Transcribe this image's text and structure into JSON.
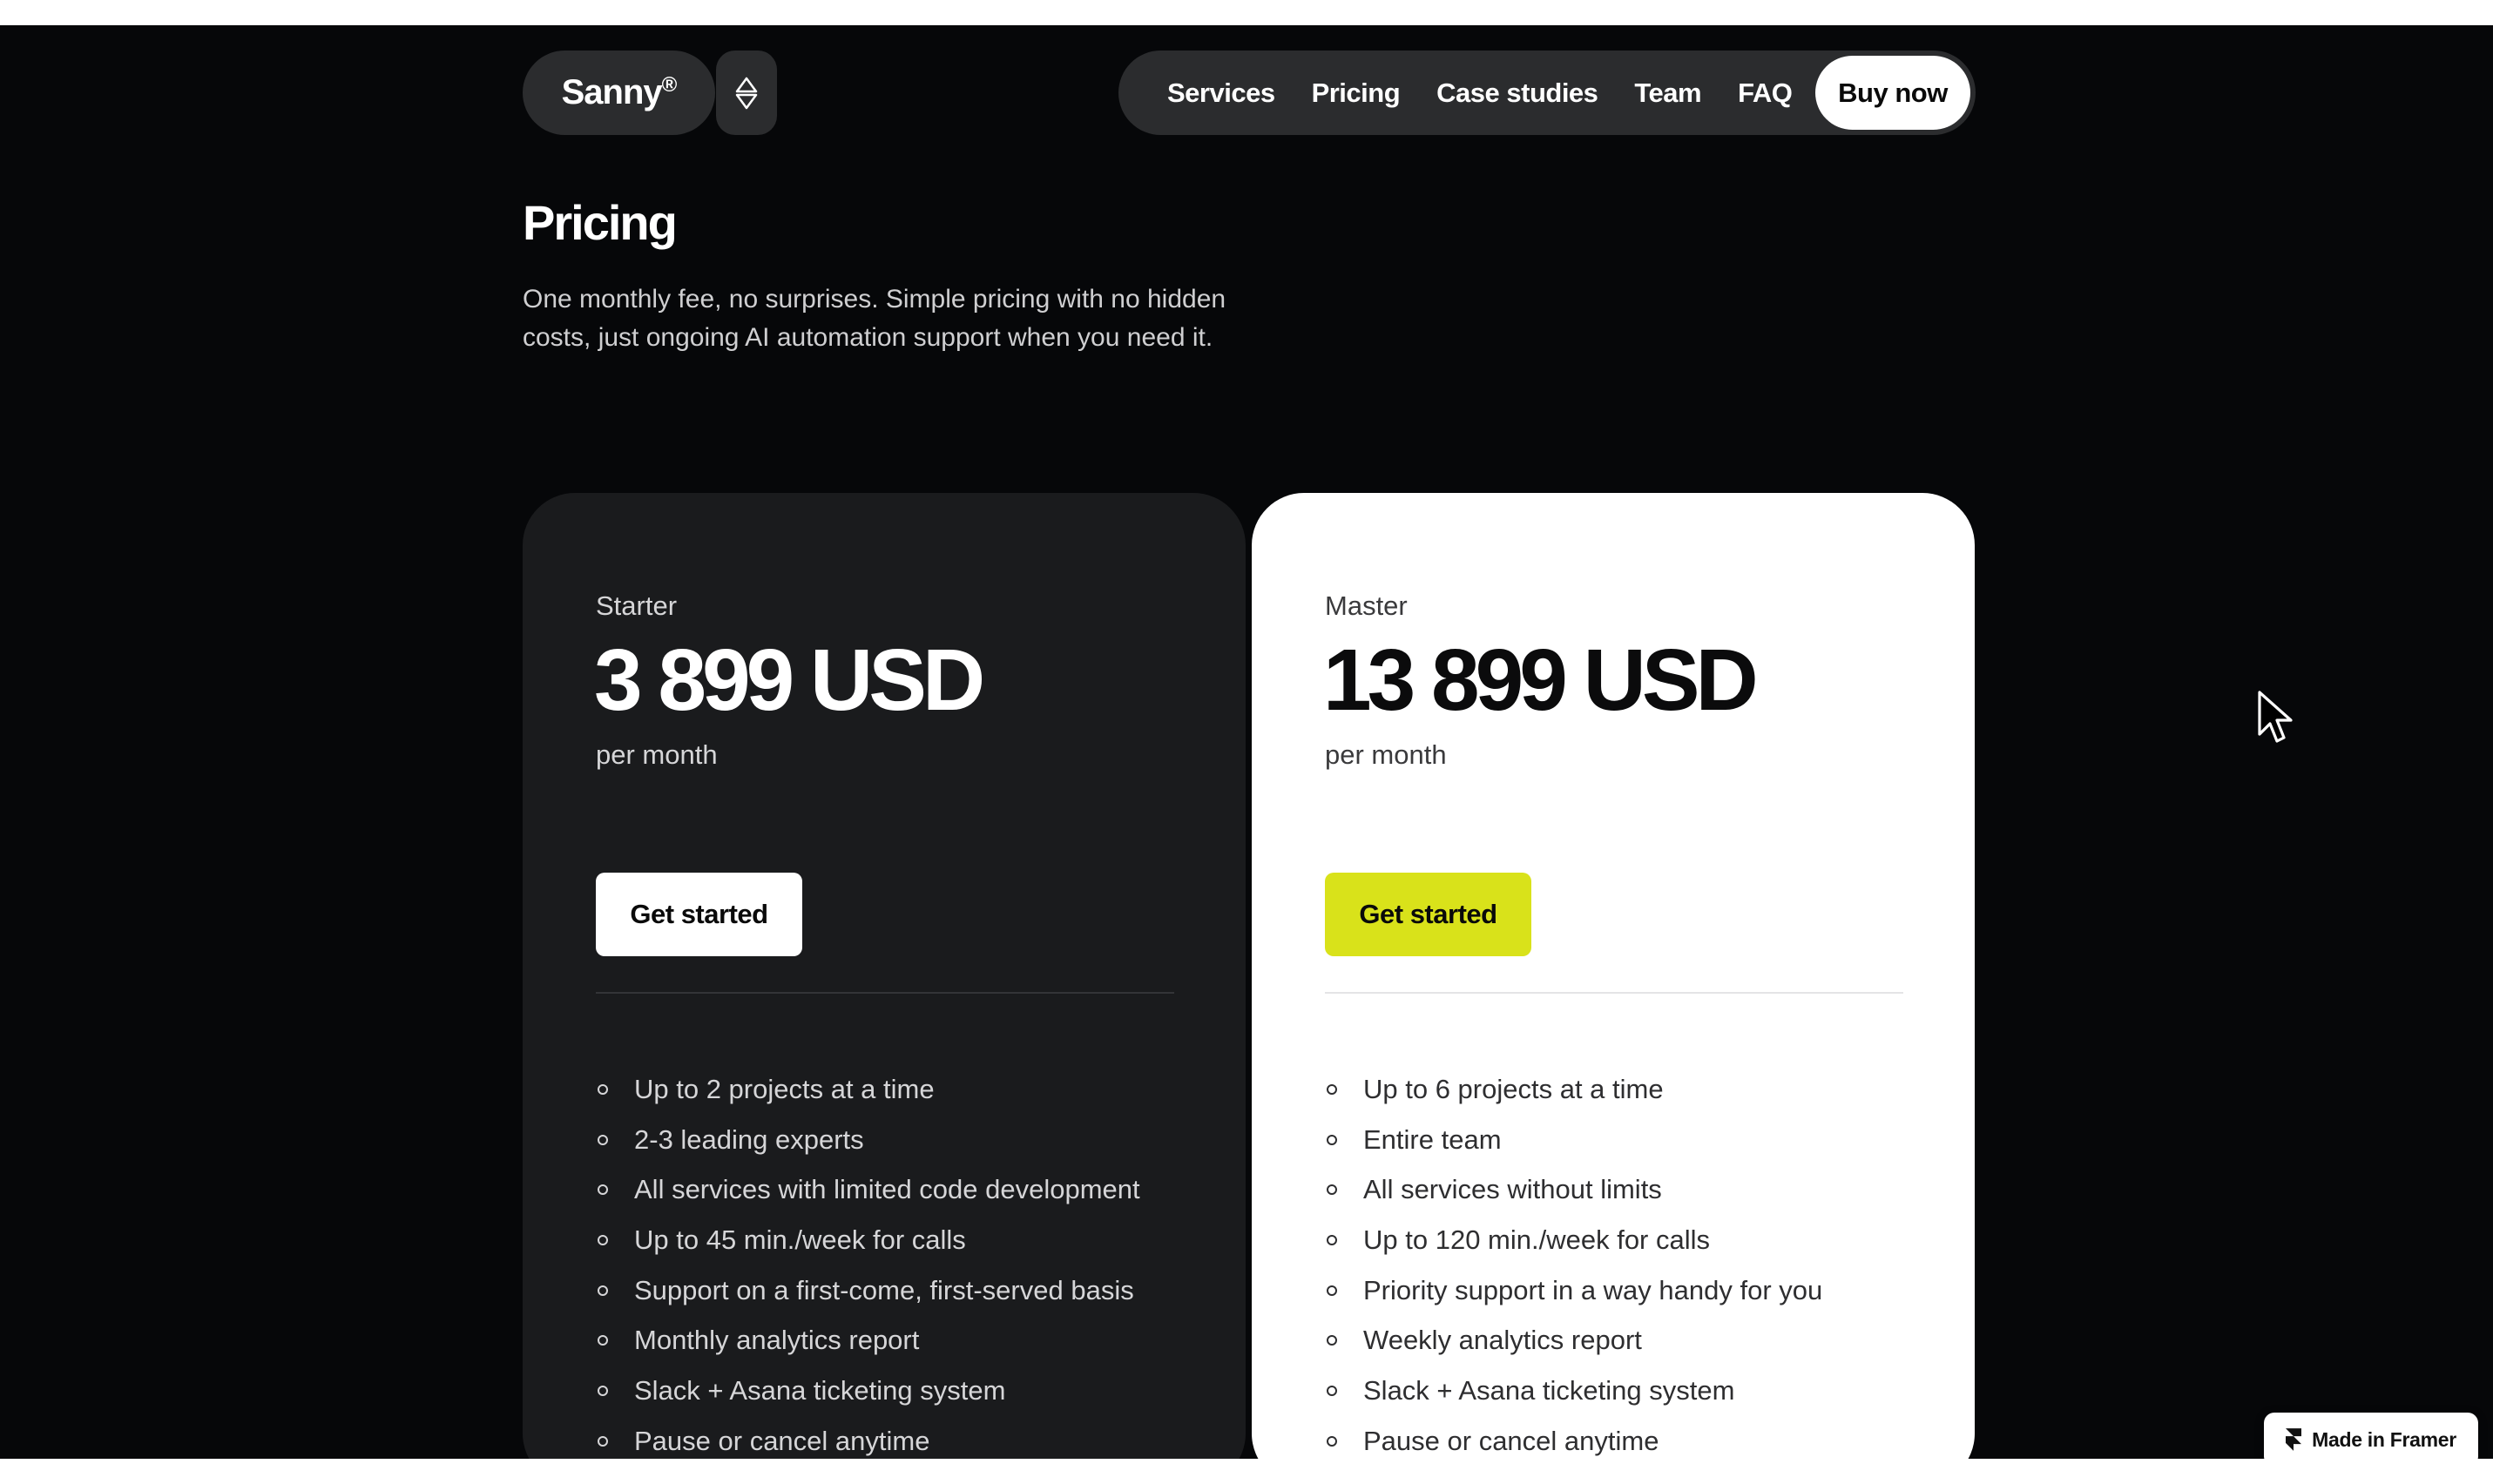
{
  "header": {
    "logo": "Sanny",
    "logo_mark": "®",
    "nav": [
      "Services",
      "Pricing",
      "Case studies",
      "Team",
      "FAQ"
    ],
    "buy_label": "Buy now"
  },
  "intro": {
    "title": "Pricing",
    "description": "One monthly fee, no surprises. Simple pricing with no hidden costs, just ongoing AI automation support when you need it."
  },
  "plans": [
    {
      "name": "Starter",
      "price": "3 899 USD",
      "period": "per month",
      "cta": "Get started",
      "features": [
        "Up to 2 projects at a time",
        "2-3 leading experts",
        "All services with limited code development",
        "Up to 45 min./week for calls",
        "Support on a first-come, first-served basis",
        "Monthly analytics report",
        "Slack + Asana ticketing system",
        "Pause or cancel anytime"
      ]
    },
    {
      "name": "Master",
      "price": "13 899 USD",
      "period": "per month",
      "cta": "Get started",
      "features": [
        "Up to 6 projects at a time",
        "Entire team",
        "All services without limits",
        "Up to 120 min./week for calls",
        "Priority support in a way handy for you",
        "Weekly analytics report",
        "Slack + Asana ticketing system",
        "Pause or cancel anytime"
      ]
    }
  ],
  "badge": {
    "label": "Made in Framer",
    "icon": "framer-icon"
  },
  "colors": {
    "background": "#060709",
    "pill": "#2b2c2e",
    "dark_card": "#1a1b1d",
    "light_card": "#ffffff",
    "accent": "#d9e21a"
  }
}
